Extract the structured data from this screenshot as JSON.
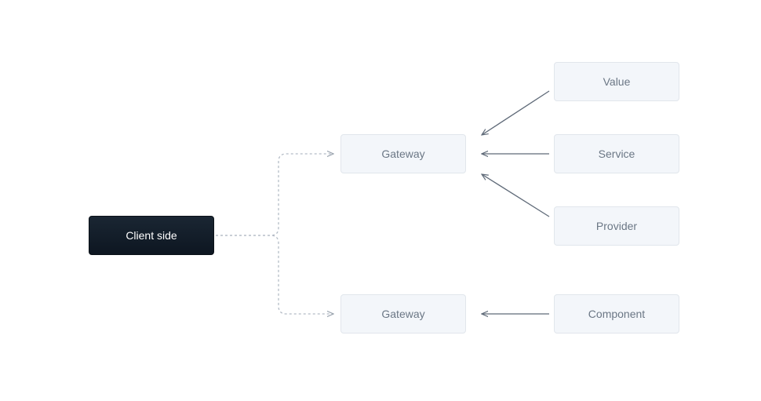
{
  "nodes": {
    "client": {
      "label": "Client side"
    },
    "gateway1": {
      "label": "Gateway"
    },
    "gateway2": {
      "label": "Gateway"
    },
    "value": {
      "label": "Value"
    },
    "service": {
      "label": "Service"
    },
    "provider": {
      "label": "Provider"
    },
    "component": {
      "label": "Component"
    }
  }
}
